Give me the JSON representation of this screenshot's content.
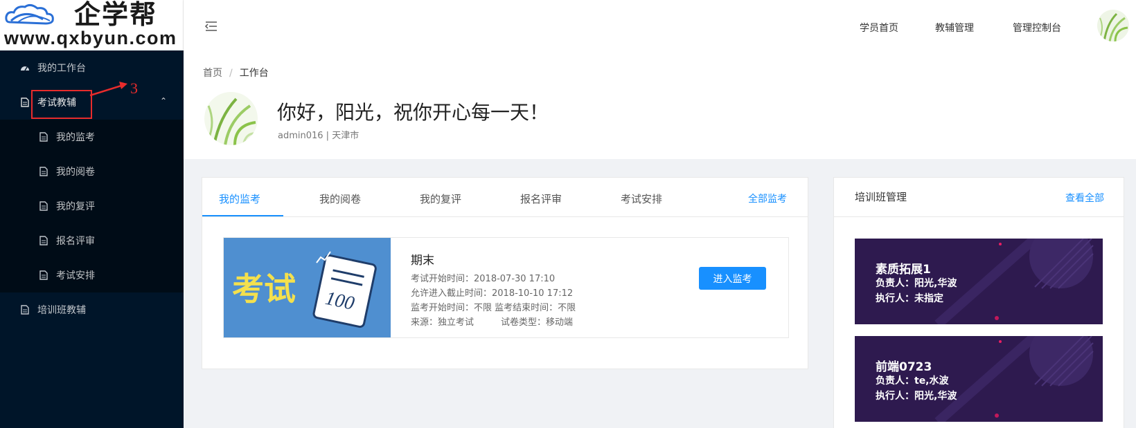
{
  "logo": {
    "name_cn": "企学帮",
    "url": "www.qxbyun.com"
  },
  "sidebar": {
    "items": [
      {
        "label": "我的工作台",
        "icon": "dashboard-icon"
      },
      {
        "label": "考试教辅",
        "icon": "document-icon",
        "expanded": true
      },
      {
        "label": "培训班教辅",
        "icon": "document-icon"
      }
    ],
    "submenu": [
      {
        "label": "我的监考",
        "icon": "document-icon"
      },
      {
        "label": "我的阅卷",
        "icon": "document-icon"
      },
      {
        "label": "我的复评",
        "icon": "document-icon"
      },
      {
        "label": "报名评审",
        "icon": "document-icon"
      },
      {
        "label": "考试安排",
        "icon": "document-icon"
      }
    ]
  },
  "annotation": {
    "number": "3"
  },
  "header": {
    "nav": [
      "学员首页",
      "教辅管理",
      "管理控制台"
    ]
  },
  "breadcrumb": {
    "home": "首页",
    "separator": "/",
    "current": "工作台"
  },
  "greeting": {
    "title": "你好，阳光，祝你开心每一天！",
    "subtitle": "admin016 | 天津市"
  },
  "exam_panel": {
    "tabs": [
      "我的监考",
      "我的阅卷",
      "我的复评",
      "报名评审",
      "考试安排"
    ],
    "active_tab": 0,
    "all_link": "全部监考",
    "item": {
      "thumb_text": "考试",
      "thumb_score": "100",
      "title": "期末",
      "lines": [
        "考试开始时间：2018-07-30 17:10",
        "允许进入截止时间：2018-10-10 17:12",
        "监考开始时间：不限 监考结束时间：不限",
        "来源：独立考试　　　试卷类型：移动端"
      ],
      "button": "进入监考"
    }
  },
  "training_panel": {
    "title": "培训班管理",
    "view_all": "查看全部",
    "classes": [
      {
        "name": "素质拓展1",
        "owner": "负责人：阳光,华波",
        "executor": "执行人：未指定"
      },
      {
        "name": "前端0723",
        "owner": "负责人：te,水波",
        "executor": "执行人：阳光,华波"
      }
    ]
  },
  "colors": {
    "sidebar_bg": "#001529",
    "accent": "#1890ff",
    "annotation": "#e82c2c",
    "class_card": "#2d1b4e"
  }
}
